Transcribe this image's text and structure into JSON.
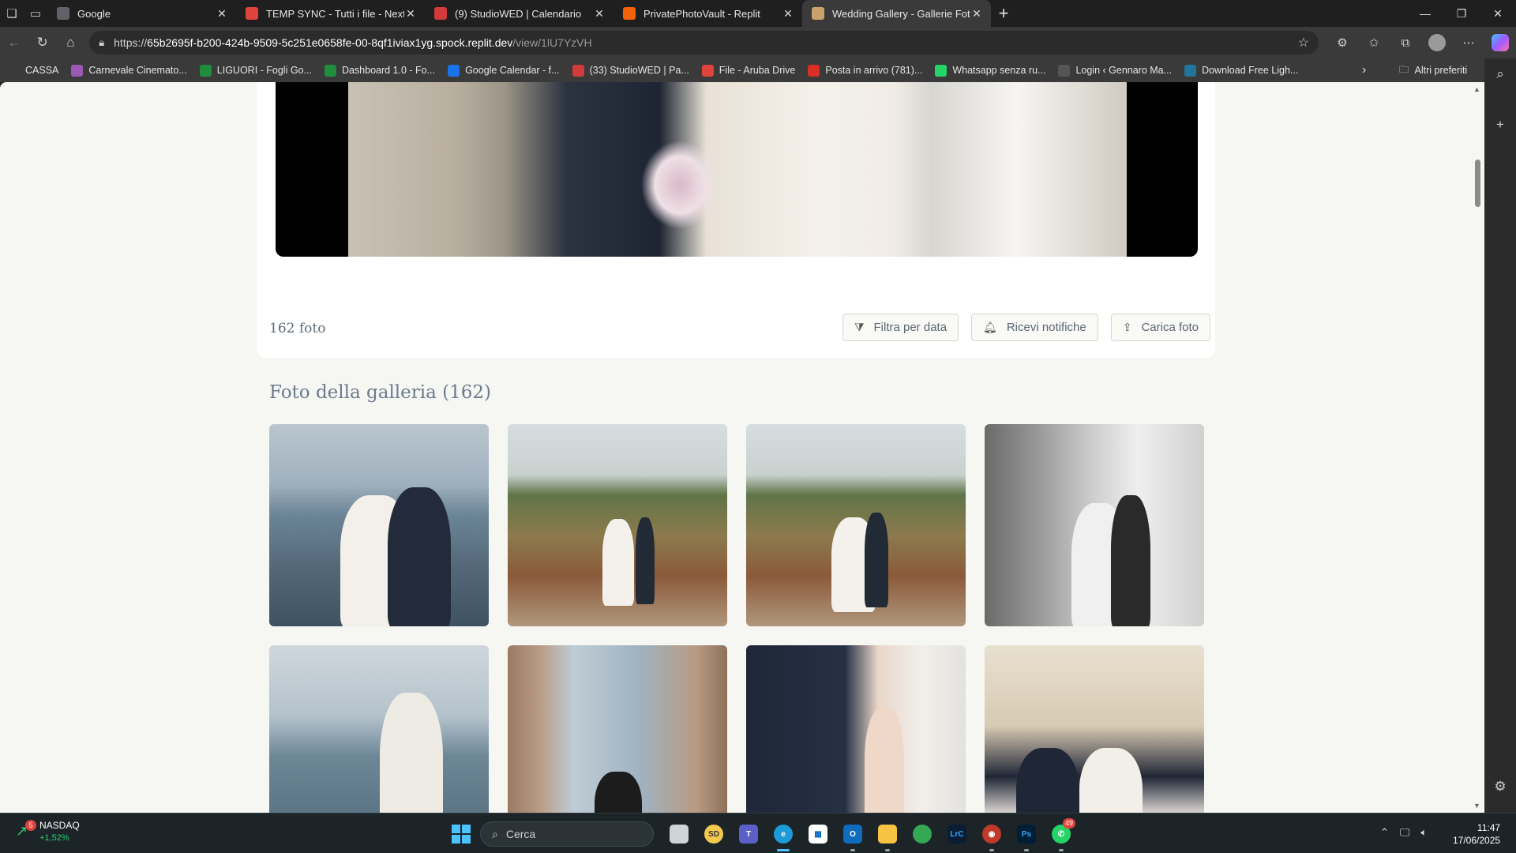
{
  "browser": {
    "tabs": [
      {
        "label": "Google",
        "favicon_color": "#5f6368",
        "active": false
      },
      {
        "label": "TEMP SYNC - Tutti i file - Nextclo",
        "favicon_color": "#e0433b",
        "active": false
      },
      {
        "label": "(9) StudioWED | Calendario",
        "favicon_color": "#d23b3b",
        "active": false
      },
      {
        "label": "PrivatePhotoVault - Replit",
        "favicon_color": "#f26207",
        "active": false
      },
      {
        "label": "Wedding Gallery - Gallerie Fotogr",
        "favicon_color": "#c9a46a",
        "active": true
      }
    ],
    "url_prefix": "https://",
    "url_host": "65b2695f-b200-424b-9509-5c251e0658fe-00-8qf1iviax1yg.spock.replit.dev",
    "url_path": "/view/1lU7YzVH",
    "bookmarks": [
      {
        "label": "CASSA",
        "color": "#3a3a3a"
      },
      {
        "label": "Carnevale Cinemato...",
        "color": "#9b59b6"
      },
      {
        "label": "LIGUORI - Fogli Go...",
        "color": "#1e8e3e"
      },
      {
        "label": "Dashboard 1.0 - Fo...",
        "color": "#1e8e3e"
      },
      {
        "label": "Google Calendar - f...",
        "color": "#1a73e8"
      },
      {
        "label": "(33) StudioWED | Pa...",
        "color": "#d23b3b"
      },
      {
        "label": "File - Aruba Drive",
        "color": "#e0433b"
      },
      {
        "label": "Posta in arrivo (781)...",
        "color": "#d93025"
      },
      {
        "label": "Whatsapp senza ru...",
        "color": "#25d366"
      },
      {
        "label": "Login ‹ Gennaro Ma...",
        "color": "#555555"
      },
      {
        "label": "Download Free Ligh...",
        "color": "#21759b"
      }
    ],
    "other_bookmarks": "Altri preferiti"
  },
  "gallery": {
    "photo_count": "162 foto",
    "actions": {
      "filter": "Filtra per data",
      "notify": "Ricevi notifiche",
      "upload": "Carica foto"
    },
    "title": "Foto della galleria (162)",
    "photos": [
      "sea-couple",
      "bridge-walk",
      "bridge-kiss",
      "bw-door",
      "sea-lift",
      "arch-kiss",
      "hands",
      "toast"
    ]
  },
  "taskbar": {
    "ticker_name": "NASDAQ",
    "ticker_change": "+1,52%",
    "ticker_badge": "5",
    "search_placeholder": "Cerca",
    "whatsapp_count": "49",
    "time": "11:47",
    "date": "17/06/2025"
  }
}
